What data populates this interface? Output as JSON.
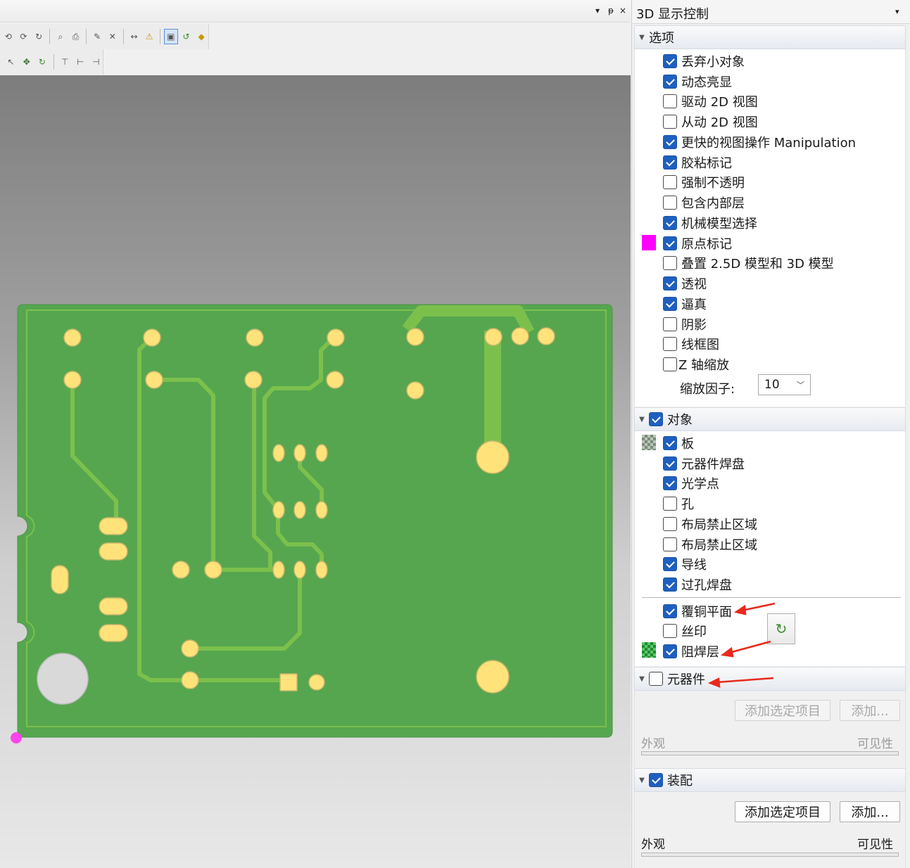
{
  "panel": {
    "title": "3D 显示控制",
    "pin_glyph": "▾",
    "options_section": {
      "label": "选项",
      "items": [
        {
          "label": "丢弃小对象",
          "checked": true
        },
        {
          "label": "动态亮显",
          "checked": true
        },
        {
          "label": "驱动 2D 视图",
          "checked": false
        },
        {
          "label": "从动 2D 视图",
          "checked": false
        },
        {
          "label": "更快的视图操作 Manipulation",
          "checked": true
        },
        {
          "label": "胶粘标记",
          "checked": true
        },
        {
          "label": "强制不透明",
          "checked": false
        },
        {
          "label": "包含内部层",
          "checked": false
        },
        {
          "label": "机械模型选择",
          "checked": true
        },
        {
          "label": "原点标记",
          "checked": true,
          "swatch": "#ff00ff"
        },
        {
          "label": "叠置 2.5D 模型和 3D 模型",
          "checked": false
        },
        {
          "label": "透视",
          "checked": true
        },
        {
          "label": "逼真",
          "checked": true
        },
        {
          "label": "阴影",
          "checked": false
        },
        {
          "label": "线框图",
          "checked": false
        },
        {
          "label": "Z 轴缩放",
          "checked": false
        }
      ],
      "scale_factor_label": "缩放因子:",
      "scale_factor_value": "10"
    },
    "objects_section": {
      "label": "对象",
      "checked": true,
      "items": [
        {
          "label": "板",
          "checked": true
        },
        {
          "label": "元器件焊盘",
          "checked": true
        },
        {
          "label": "光学点",
          "checked": true
        },
        {
          "label": "孔",
          "checked": false
        },
        {
          "label": "布局禁止区域",
          "checked": false
        },
        {
          "label": "布局禁止区域",
          "checked": false
        },
        {
          "label": "导线",
          "checked": true
        },
        {
          "label": "过孔焊盘",
          "checked": true
        },
        {
          "label": "覆铜平面",
          "checked": true
        },
        {
          "label": "丝印",
          "checked": false
        },
        {
          "label": "阻焊层",
          "checked": true
        }
      ]
    },
    "components_section": {
      "label": "元器件",
      "checked": false,
      "add_selected_label": "添加选定项目",
      "add_label": "添加...",
      "col_appearance": "外观",
      "col_visibility": "可见性"
    },
    "assembly_section": {
      "label": "装配",
      "checked": true,
      "add_selected_label": "添加选定项目",
      "add_label": "添加...",
      "col_appearance": "外观",
      "col_visibility": "可见性"
    }
  },
  "colors": {
    "board_green": "#56a64f",
    "trace_green": "#7cc04c",
    "pad_yellow": "#ffe37a",
    "origin_marker": "#ff44ee",
    "annotation_red": "#e8291c"
  }
}
